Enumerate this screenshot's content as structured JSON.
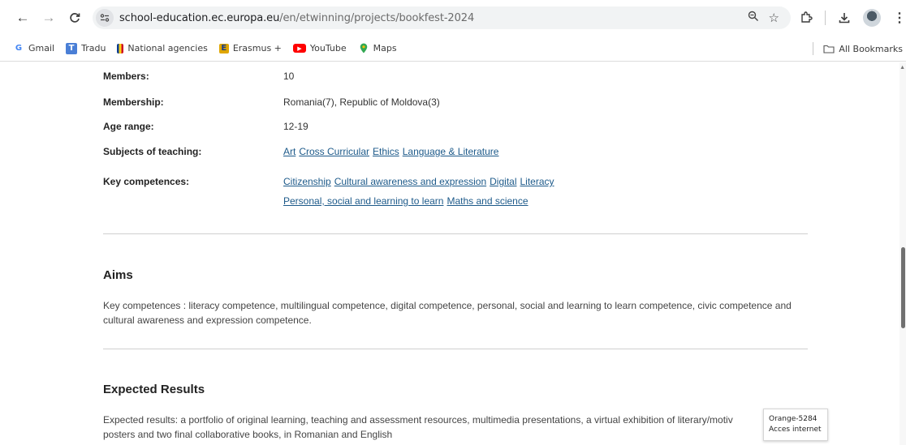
{
  "browser": {
    "url_host": "school-education.ec.europa.eu",
    "url_path": "/en/etwinning/projects/bookfest-2024",
    "bookmarks": [
      {
        "label": "Gmail",
        "icon": "G",
        "color": "#4285f4"
      },
      {
        "label": "Tradu",
        "icon": "T",
        "color": "#4a7fd6"
      },
      {
        "label": "National agencies",
        "icon": "N",
        "color": "#f0b400"
      },
      {
        "label": "Erasmus +",
        "icon": "E",
        "color": "#d8a000"
      },
      {
        "label": "YouTube",
        "icon": "▶",
        "color": "#ff0000"
      },
      {
        "label": "Maps",
        "icon": "◉",
        "color": "#34a853"
      }
    ],
    "all_bookmarks_label": "All Bookmarks"
  },
  "details": {
    "members_label": "Members:",
    "members_value": "10",
    "membership_label": "Membership:",
    "membership_value": "Romania(7), Republic of Moldova(3)",
    "age_label": "Age range:",
    "age_value": "12-19",
    "subjects_label": "Subjects of teaching:",
    "subjects": [
      "Art",
      "Cross Curricular",
      "Ethics",
      "Language & Literature"
    ],
    "competences_label": "Key competences:",
    "competences_line1": [
      "Citizenship",
      "Cultural awareness and expression",
      "Digital",
      "Literacy"
    ],
    "competences_line2": [
      "Personal, social and learning to learn",
      "Maths and science"
    ]
  },
  "aims": {
    "title": "Aims",
    "text": "Key competences : literacy competence, multilingual competence, digital competence, personal, social and learning to learn competence, civic competence and cultural awareness and expression competence."
  },
  "expected": {
    "title": "Expected Results",
    "line1": "Expected results: a portfolio of original learning, teaching and assessment resources, multimedia presentations, a virtual exhibition of literary/motiv",
    "line2": "posters and two final collaborative books, in Romanian and English"
  },
  "tooltip": {
    "line1": "Orange-5284",
    "line2": "Acces internet"
  }
}
